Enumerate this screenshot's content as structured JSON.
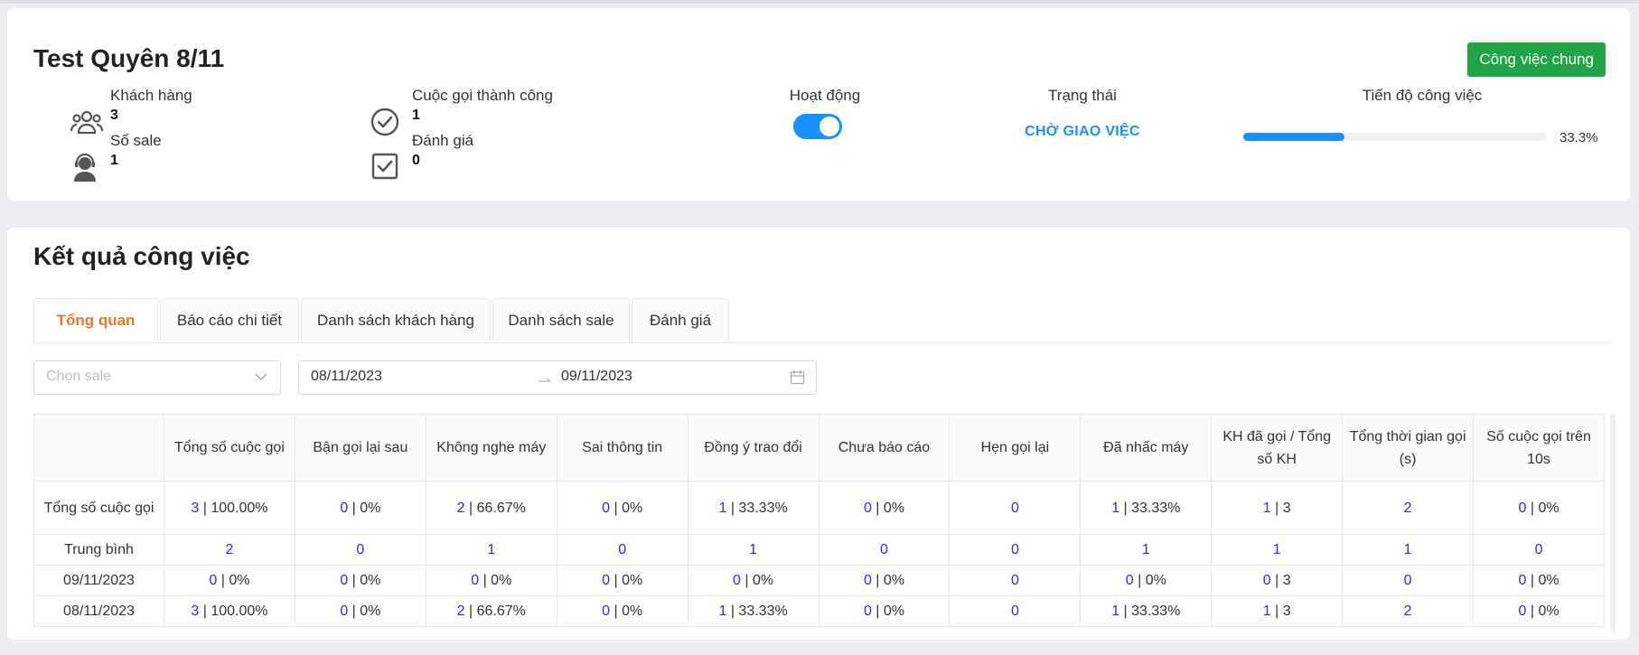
{
  "header": {
    "title": "Test Quyên 8/11",
    "action_button": "Công việc chung",
    "stats": [
      {
        "label": "Khách hàng",
        "value": "3",
        "icon": "users-icon"
      },
      {
        "label": "Số sale",
        "value": "1",
        "icon": "headset-user-icon"
      },
      {
        "label": "Cuộc gọi thành công",
        "value": "1",
        "icon": "check-circle-icon"
      },
      {
        "label": "Đánh giá",
        "value": "0",
        "icon": "check-square-icon"
      }
    ],
    "activity_label": "Hoạt động",
    "activity_on": true,
    "status_label": "Trạng thái",
    "status_value": "CHỜ GIAO VIỆC",
    "progress_label": "Tiến độ công việc",
    "progress_text": "33.3%",
    "progress_fraction": 0.333
  },
  "results": {
    "title": "Kết quả công việc",
    "tabs": [
      "Tổng quan",
      "Báo cáo chi tiết",
      "Danh sách khách hàng",
      "Danh sách sale",
      "Đánh giá"
    ],
    "active_tab": 0,
    "sale_select_placeholder": "Chọn sale",
    "date_from": "08/11/2023",
    "date_to": "09/11/2023",
    "table": {
      "columns": [
        "",
        "Tổng số cuộc gọi",
        "Bận gọi lại sau",
        "Không nghe máy",
        "Sai thông tin",
        "Đồng ý trao đổi",
        "Chưa báo cáo",
        "Hẹn gọi lại",
        "Đã nhấc máy",
        "KH đã gọi / Tổng số KH",
        "Tổng thời gian gọi (s)",
        "Số cuộc gọi trên 10s"
      ],
      "rows": [
        {
          "label": "Tổng số cuộc gọi",
          "cells": [
            [
              "3",
              " | 100.00%"
            ],
            [
              "0",
              " | 0%"
            ],
            [
              "2",
              " | 66.67%"
            ],
            [
              "0",
              " | 0%"
            ],
            [
              "1",
              " | 33.33%"
            ],
            [
              "0",
              " | 0%"
            ],
            [
              "0",
              ""
            ],
            [
              "1",
              " | 33.33%"
            ],
            [
              "1",
              " | 3"
            ],
            [
              "2",
              ""
            ],
            [
              "0",
              " | 0%"
            ]
          ]
        },
        {
          "label": "Trung bình",
          "cells": [
            [
              "2",
              ""
            ],
            [
              "0",
              ""
            ],
            [
              "1",
              ""
            ],
            [
              "0",
              ""
            ],
            [
              "1",
              ""
            ],
            [
              "0",
              ""
            ],
            [
              "0",
              ""
            ],
            [
              "1",
              ""
            ],
            [
              "1",
              ""
            ],
            [
              "1",
              ""
            ],
            [
              "0",
              ""
            ]
          ]
        },
        {
          "label": "09/11/2023",
          "cells": [
            [
              "0",
              " | 0%"
            ],
            [
              "0",
              " | 0%"
            ],
            [
              "0",
              " | 0%"
            ],
            [
              "0",
              " | 0%"
            ],
            [
              "0",
              " | 0%"
            ],
            [
              "0",
              " | 0%"
            ],
            [
              "0",
              ""
            ],
            [
              "0",
              " | 0%"
            ],
            [
              "0",
              " | 3"
            ],
            [
              "0",
              ""
            ],
            [
              "0",
              " | 0%"
            ]
          ]
        },
        {
          "label": "08/11/2023",
          "cells": [
            [
              "3",
              " | 100.00%"
            ],
            [
              "0",
              " | 0%"
            ],
            [
              "2",
              " | 66.67%"
            ],
            [
              "0",
              " | 0%"
            ],
            [
              "1",
              " | 33.33%"
            ],
            [
              "0",
              " | 0%"
            ],
            [
              "0",
              ""
            ],
            [
              "1",
              " | 33.33%"
            ],
            [
              "1",
              " | 3"
            ],
            [
              "2",
              ""
            ],
            [
              "0",
              " | 0%"
            ]
          ]
        }
      ]
    }
  },
  "colors": {
    "accent": "#1890ff",
    "primary_button": "#22a446",
    "active_tab": "#e8772e",
    "link_number": "#2b2fd9"
  }
}
